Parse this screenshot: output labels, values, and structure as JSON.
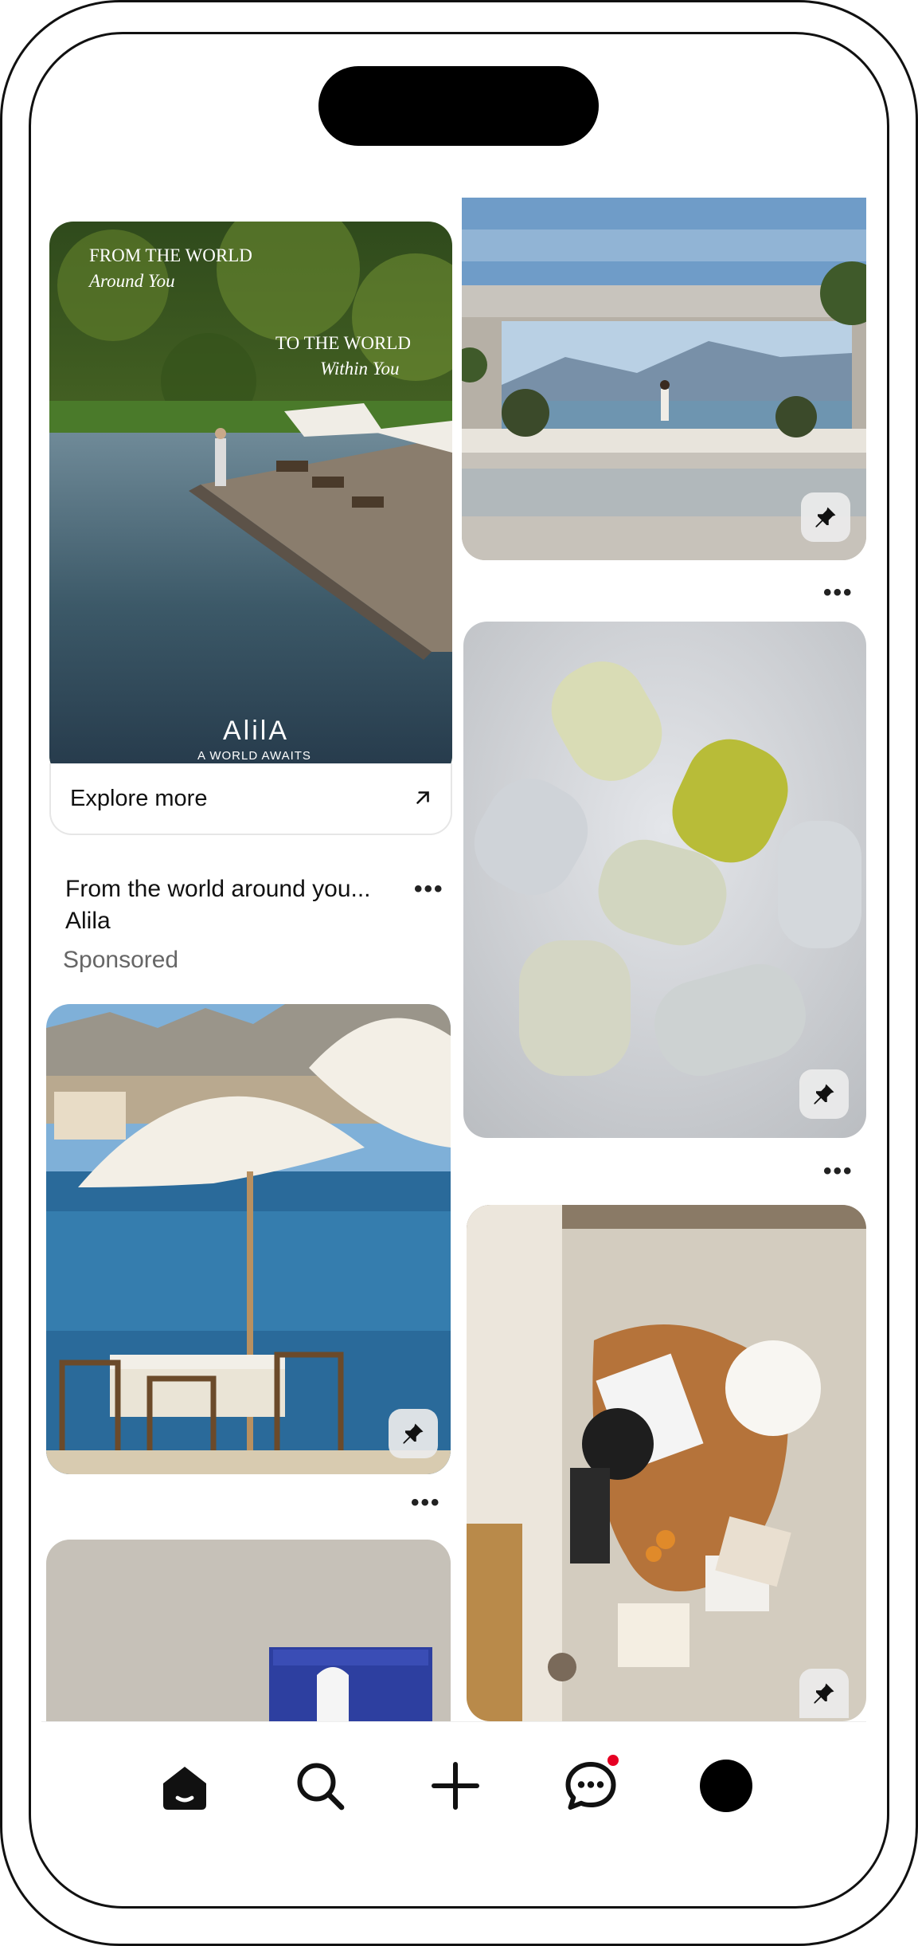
{
  "feed": {
    "ad_pin": {
      "overlay_line1": "FROM THE WORLD",
      "overlay_line2": "Around You",
      "overlay_line3": "TO THE WORLD",
      "overlay_line4": "Within You",
      "brand_logo": "AlilA",
      "brand_tagline": "A WORLD AWAITS",
      "cta_label": "Explore more",
      "title": "From the world around you...",
      "advertiser": "Alila",
      "sponsored_label": "Sponsored",
      "more_label": "•••"
    },
    "pins": [
      {
        "id": "villa-pool",
        "more_label": "•••"
      },
      {
        "id": "bottles",
        "more_label": "•••"
      },
      {
        "id": "beach-umbrella",
        "more_label": "•••"
      },
      {
        "id": "living-room"
      },
      {
        "id": "blue-box"
      }
    ]
  },
  "tabbar": {
    "items": [
      {
        "name": "home",
        "icon": "home-icon",
        "active": true
      },
      {
        "name": "search",
        "icon": "search-icon"
      },
      {
        "name": "create",
        "icon": "plus-icon"
      },
      {
        "name": "messages",
        "icon": "chat-icon",
        "has_notification": true
      },
      {
        "name": "profile",
        "icon": "avatar"
      }
    ]
  },
  "colors": {
    "notification": "#e60023",
    "text_primary": "#111111",
    "text_secondary": "#666666"
  }
}
